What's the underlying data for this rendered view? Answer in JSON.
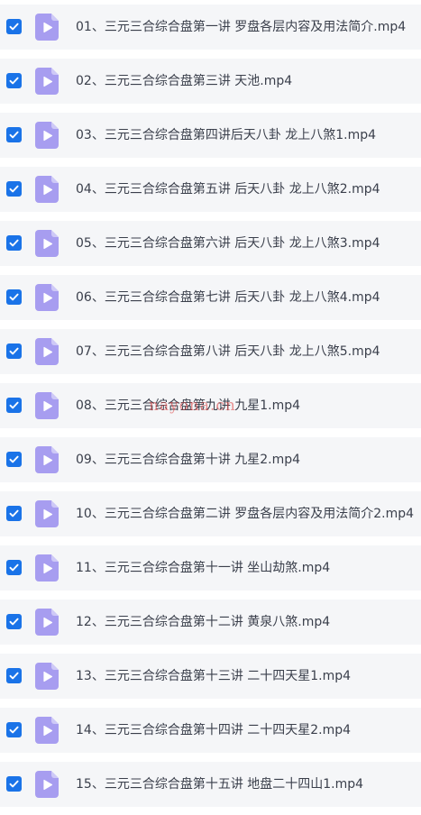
{
  "colors": {
    "checkbox": "#1a73e8",
    "file_icon": "#a79df0",
    "file_icon_glyph": "#ffffff",
    "row_background": "#f5f6f8",
    "text": "#3a3f4b",
    "watermark": "#dc3c3c"
  },
  "icons": {
    "checkbox": "checkmark-icon",
    "file": "video-file-icon"
  },
  "watermark": "nayona.cn",
  "files": [
    {
      "name": "01、三元三合综合盘第一讲 罗盘各层内容及用法简介.mp4",
      "checked": true
    },
    {
      "name": "02、三元三合综合盘第三讲 天池.mp4",
      "checked": true
    },
    {
      "name": "03、三元三合综合盘第四讲后天八卦 龙上八煞1.mp4",
      "checked": true
    },
    {
      "name": "04、三元三合综合盘第五讲 后天八卦 龙上八煞2.mp4",
      "checked": true
    },
    {
      "name": "05、三元三合综合盘第六讲 后天八卦 龙上八煞3.mp4",
      "checked": true
    },
    {
      "name": "06、三元三合综合盘第七讲 后天八卦 龙上八煞4.mp4",
      "checked": true
    },
    {
      "name": "07、三元三合综合盘第八讲 后天八卦 龙上八煞5.mp4",
      "checked": true
    },
    {
      "name": "08、三元三合综合盘第九讲 九星1.mp4",
      "checked": true
    },
    {
      "name": "09、三元三合综合盘第十讲 九星2.mp4",
      "checked": true
    },
    {
      "name": "10、三元三合综合盘第二讲 罗盘各层内容及用法简介2.mp4",
      "checked": true
    },
    {
      "name": "11、三元三合综合盘第十一讲 坐山劫煞.mp4",
      "checked": true
    },
    {
      "name": "12、三元三合综合盘第十二讲 黄泉八煞.mp4",
      "checked": true
    },
    {
      "name": "13、三元三合综合盘第十三讲 二十四天星1.mp4",
      "checked": true
    },
    {
      "name": "14、三元三合综合盘第十四讲 二十四天星2.mp4",
      "checked": true
    },
    {
      "name": "15、三元三合综合盘第十五讲 地盘二十四山1.mp4",
      "checked": true
    }
  ]
}
